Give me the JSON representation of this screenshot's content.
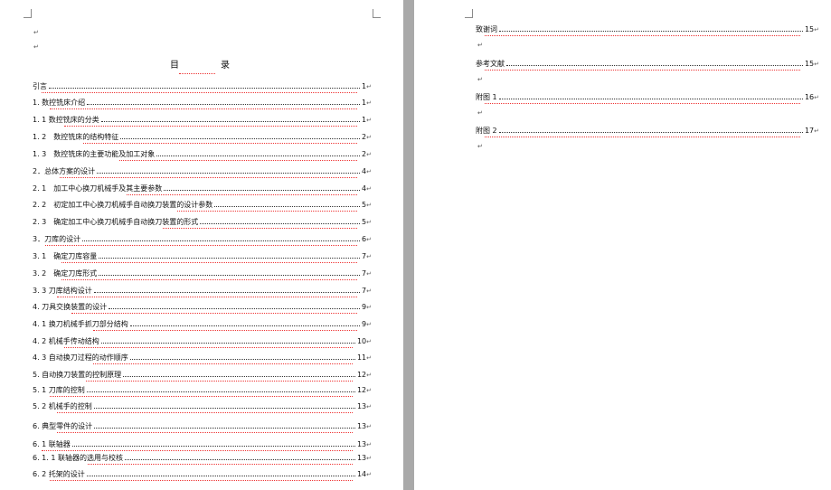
{
  "toc": {
    "title_left": "目",
    "title_right": "录",
    "left_entries": [
      {
        "label": "引言",
        "page": "1"
      },
      {
        "label": "1. 数控铣床介绍",
        "page": "1"
      },
      {
        "label": "1. 1 数控铣床的分类",
        "page": "1"
      },
      {
        "label": "1. 2　数控铣床的结构特征",
        "page": "2"
      },
      {
        "label": "1. 3　数控铣床的主要功能及加工对象",
        "page": "2"
      },
      {
        "label": "2．总体方案的设计",
        "page": "4"
      },
      {
        "label": "2. 1　加工中心换刀机械手及其主要参数",
        "page": "4"
      },
      {
        "label": "2. 2　初定加工中心换刀机械手自动换刀装置的设计参数",
        "page": "5"
      },
      {
        "label": "2. 3　确定加工中心换刀机械手自动换刀装置的形式",
        "page": "5"
      },
      {
        "label": "3．刀库的设计",
        "page": "6"
      },
      {
        "label": "3. 1　确定刀库容量",
        "page": "7"
      },
      {
        "label": "3. 2　确定刀库形式",
        "page": "7"
      },
      {
        "label": "3. 3 刀库结构设计",
        "page": "7"
      },
      {
        "label": "4. 刀具交换装置的设计",
        "page": "9"
      },
      {
        "label": "4. 1 换刀机械手抓刀部分结构",
        "page": "9"
      },
      {
        "label": "4. 2 机械手传动结构",
        "page": "10"
      },
      {
        "label": "4. 3 自动换刀过程的动作顺序",
        "page": "11"
      },
      {
        "label": "5. 自动换刀装置的控制原理",
        "page": "12"
      },
      {
        "label": "5. 1 刀库的控制",
        "page": "12"
      },
      {
        "label": "5. 2 机械手的控制",
        "page": "13"
      },
      {
        "label": "6. 典型零件的设计",
        "page": "13"
      },
      {
        "label": "6. 1 联轴器",
        "page": "13"
      },
      {
        "label": "6. 1. 1 联轴器的选用与校核",
        "page": "13"
      },
      {
        "label": "6. 2 托架的设计",
        "page": "14"
      }
    ],
    "right_entries": [
      {
        "label": "致谢词",
        "page": "15"
      },
      {
        "label": "参考文献",
        "page": "15"
      },
      {
        "label": "附图 1",
        "page": "16"
      },
      {
        "label": "附图 2",
        "page": "17"
      }
    ]
  }
}
